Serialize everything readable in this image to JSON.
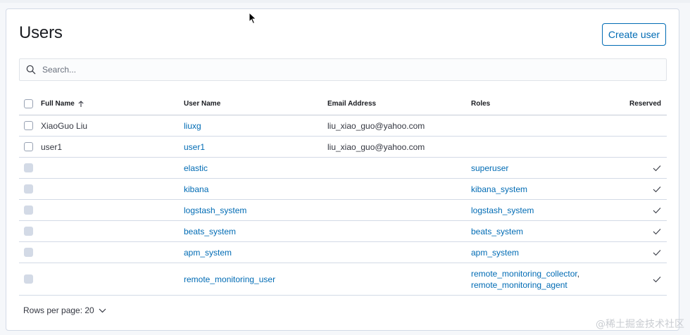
{
  "page": {
    "title": "Users",
    "create_button": "Create user"
  },
  "search": {
    "placeholder": "Search..."
  },
  "table": {
    "headers": {
      "full_name": "Full Name",
      "user_name": "User Name",
      "email": "Email Address",
      "roles": "Roles",
      "reserved": "Reserved"
    },
    "rows": [
      {
        "full_name": "XiaoGuo Liu",
        "user_name": "liuxg",
        "email": "liu_xiao_guo@yahoo.com",
        "roles": "",
        "reserved": false
      },
      {
        "full_name": "user1",
        "user_name": "user1",
        "email": "liu_xiao_guo@yahoo.com",
        "roles": "",
        "reserved": false
      },
      {
        "full_name": "",
        "user_name": "elastic",
        "email": "",
        "roles": "superuser",
        "reserved": true
      },
      {
        "full_name": "",
        "user_name": "kibana",
        "email": "",
        "roles": "kibana_system",
        "reserved": true
      },
      {
        "full_name": "",
        "user_name": "logstash_system",
        "email": "",
        "roles": "logstash_system",
        "reserved": true
      },
      {
        "full_name": "",
        "user_name": "beats_system",
        "email": "",
        "roles": "beats_system",
        "reserved": true
      },
      {
        "full_name": "",
        "user_name": "apm_system",
        "email": "",
        "roles": "apm_system",
        "reserved": true
      },
      {
        "full_name": "",
        "user_name": "remote_monitoring_user",
        "email": "",
        "roles_1": "remote_monitoring_collector",
        "roles_2": "remote_monitoring_agent",
        "reserved": true
      }
    ]
  },
  "pagination": {
    "rows_per_page": "Rows per page: 20"
  },
  "watermark": "@稀土掘金技术社区",
  "colors": {
    "link": "#006bb4",
    "border": "#d3dae6"
  }
}
